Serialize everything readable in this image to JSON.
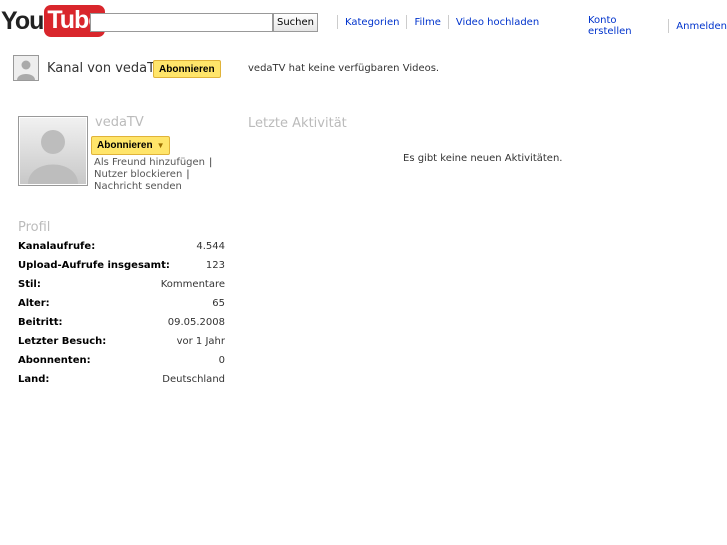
{
  "header": {
    "logo_you": "You",
    "logo_tube": "Tube",
    "search_value": "",
    "search_button": "Suchen",
    "nav_left": [
      "Kategorien",
      "Filme",
      "Video hochladen"
    ],
    "nav_right": [
      "Konto erstellen",
      "Anmelden"
    ]
  },
  "channel": {
    "title": "Kanal von vedaTV",
    "subscribe_label": "Abonnieren",
    "no_videos": "vedaTV hat keine verfügbaren Videos."
  },
  "profile": {
    "name": "vedaTV",
    "subscribe_label": "Abonnieren",
    "add_friend": "Als Freund hinzufügen",
    "block_user": "Nutzer blockieren",
    "send_message": "Nachricht senden",
    "separator": "|",
    "section_title": "Profil",
    "stats": [
      {
        "label": "Kanalaufrufe:",
        "value": "4.544"
      },
      {
        "label": "Upload-Aufrufe insgesamt:",
        "value": "123"
      },
      {
        "label": "Stil:",
        "value": "Kommentare"
      },
      {
        "label": "Alter:",
        "value": "65"
      },
      {
        "label": "Beitritt:",
        "value": "09.05.2008"
      },
      {
        "label": "Letzter Besuch:",
        "value": "vor 1 Jahr"
      },
      {
        "label": "Abonnenten:",
        "value": "0"
      },
      {
        "label": "Land:",
        "value": "Deutschland"
      }
    ]
  },
  "activity": {
    "title": "Letzte Aktivität",
    "empty": "Es gibt keine neuen Aktivitäten."
  },
  "colors": {
    "brand_red": "#d9262c",
    "link_blue": "#0033cc",
    "subscribe_yellow": "#ffe56a"
  }
}
